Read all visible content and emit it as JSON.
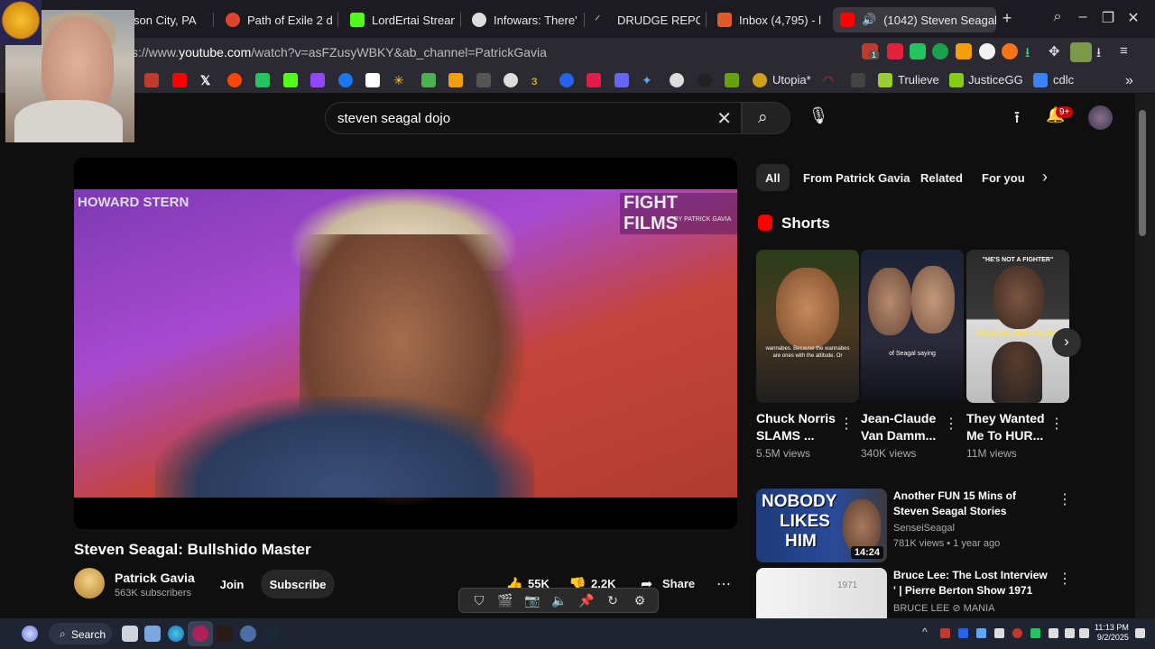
{
  "tabs": [
    {
      "label": "ckson City, PA"
    },
    {
      "label": "Path of Exile 2 de"
    },
    {
      "label": "LordErtai Stream"
    },
    {
      "label": "Infowars: There'"
    },
    {
      "label": "DRUDGE REPOR"
    },
    {
      "label": "Inbox (4,795) - l"
    },
    {
      "label": "(1042) Steven Seagal"
    }
  ],
  "browser": {
    "url_prefix": "s://www.",
    "url_host": "youtube.com",
    "url_rest": "/watch?v=asFZusyWBKY&ab_channel=PatrickGavia",
    "ext_badge": "1"
  },
  "bookmarks": [
    {
      "label": "Utopia*"
    },
    {
      "label": "Trulieve"
    },
    {
      "label": "JusticeGG"
    },
    {
      "label": "cdlc"
    }
  ],
  "youtube": {
    "search_query": "steven seagal dojo",
    "notif_badge": "9+",
    "video": {
      "title": "Steven Seagal: Bullshido Master",
      "watermark_left": "HOWARD STERN",
      "watermark_right": "FIGHT FILMS",
      "watermark_right_sub": "BY PATRICK GAVIA"
    },
    "channel": {
      "name": "Patrick Gavia",
      "subscribers": "563K subscribers",
      "join_label": "Join",
      "subscribe_label": "Subscribe"
    },
    "actions": {
      "likes": "55K",
      "dislikes": "2.2K",
      "share": "Share"
    },
    "filters": [
      "All",
      "From Patrick Gavia",
      "Related",
      "For you"
    ],
    "shorts_heading": "Shorts",
    "shorts": [
      {
        "title_1": "Chuck Norris",
        "title_2": "SLAMS ...",
        "views": "5.5M views",
        "caption": "wannabes. Because the wannabes are ones with the attitude. Or"
      },
      {
        "title_1": "Jean-Claude",
        "title_2": "Van Damm...",
        "views": "340K views",
        "caption": "of Seagal saying"
      },
      {
        "title_1": "They Wanted",
        "title_2": "Me To HUR...",
        "views": "11M views",
        "caption": "\"SEAGAL WAS SCARE",
        "caption_top": "\"HE'S NOT A FIGHTER\""
      }
    ],
    "related": [
      {
        "title": "Another FUN 15 Mins of Steven Seagal Stories",
        "channel": "SenseiSeagal",
        "meta": "781K views • 1 year ago",
        "duration": "14:24",
        "thumb_text_1": "NOBODY",
        "thumb_text_2": "LIKES",
        "thumb_text_3": "HIM"
      },
      {
        "title": "Bruce Lee: The Lost Interview ' | Pierre Berton Show 1971",
        "channel": "BRUCE LEE ⊘ MANIA",
        "meta": "",
        "thumb_text_1": "1971"
      }
    ]
  },
  "taskbar": {
    "search_label": "Search",
    "time": "11:13 PM",
    "date": "9/2/2025"
  },
  "colors": {
    "youtube_red": "#ff0000",
    "bg": "#0f0f0f",
    "accent_purple": "#a84ad0"
  }
}
